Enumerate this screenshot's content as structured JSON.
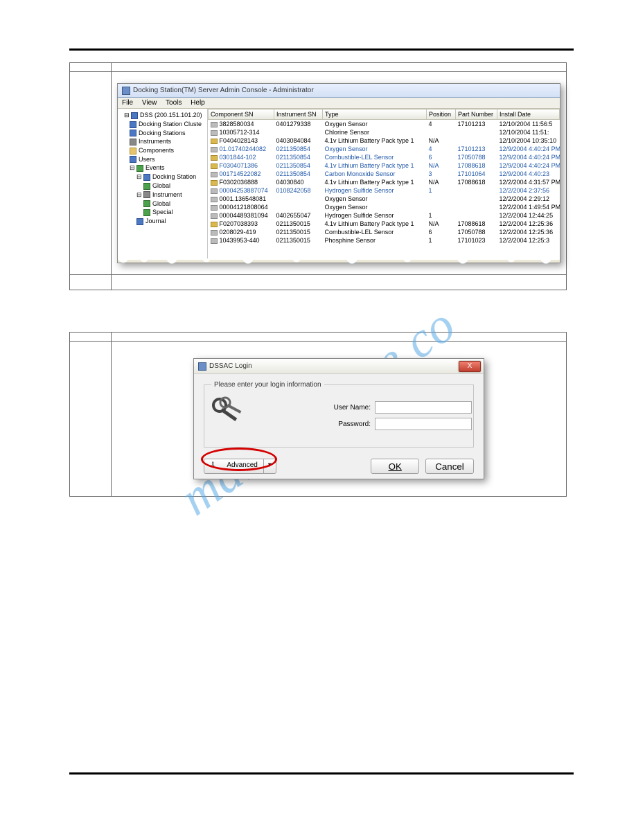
{
  "watermark": "manualshive.co",
  "table1": {
    "stepHeader": "",
    "actionHeader": ""
  },
  "admin": {
    "title": "Docking Station(TM) Server Admin Console - Administrator",
    "menu": {
      "file": "File",
      "view": "View",
      "tools": "Tools",
      "help": "Help"
    },
    "tree": {
      "root": "DSS (200.151.101.20)",
      "items": [
        "Docking Station Cluste",
        "Docking Stations",
        "Instruments",
        "Components",
        "Users",
        "Events"
      ],
      "events": {
        "dock": "Docking Station",
        "global1": "Global",
        "instrument": "Instrument",
        "global2": "Global",
        "special": "Special",
        "journal": "Journal"
      }
    },
    "cols": {
      "c0": "Component SN",
      "c1": "Instrument SN",
      "c2": "Type",
      "c3": "Position",
      "c4": "Part Number",
      "c5": "Install Date"
    },
    "rows": [
      {
        "ic": "g",
        "sn": "3828580034",
        "isn": "0401279338",
        "type": "Oxygen Sensor",
        "pos": "4",
        "pn": "17101213",
        "date": "12/10/2004 11:56:5",
        "blue": false
      },
      {
        "ic": "g",
        "sn": "10305712-314",
        "isn": "",
        "type": "Chlorine Sensor",
        "pos": "",
        "pn": "",
        "date": "12/10/2004 11:51:",
        "blue": false
      },
      {
        "ic": "y",
        "sn": "F0404028143",
        "isn": "0403084084",
        "type": "4.1v Lithium Battery Pack type 1",
        "pos": "N/A",
        "pn": "",
        "date": "12/10/2004 10:35:10",
        "blue": false
      },
      {
        "ic": "g",
        "sn": "01.01740244082",
        "isn": "0211350854",
        "type": "Oxygen Sensor",
        "pos": "4",
        "pn": "17101213",
        "date": "12/9/2004 4:40:24 PM",
        "blue": true
      },
      {
        "ic": "y",
        "sn": "0301844-102",
        "isn": "0211350854",
        "type": "Combustible-LEL Sensor",
        "pos": "6",
        "pn": "17050788",
        "date": "12/9/2004 4:40:24 PM",
        "blue": true
      },
      {
        "ic": "y",
        "sn": "F0304071386",
        "isn": "0211350854",
        "type": "4.1v Lithium Battery Pack type 1",
        "pos": "N/A",
        "pn": "17088618",
        "date": "12/9/2004 4:40:24 PM",
        "blue": true
      },
      {
        "ic": "g",
        "sn": "001714522082",
        "isn": "0211350854",
        "type": "Carbon Monoxide Sensor",
        "pos": "3",
        "pn": "17101064",
        "date": "12/9/2004 4:40:23",
        "blue": true
      },
      {
        "ic": "y",
        "sn": "F0302036888",
        "isn": "04030840",
        "type": "4.1v Lithium Battery Pack type 1",
        "pos": "N/A",
        "pn": "17088618",
        "date": "12/2/2004 4:31:57 PM",
        "blue": false
      },
      {
        "ic": "g",
        "sn": "00004253887074",
        "isn": "0108242058",
        "type": "Hydrogen Sulfide Sensor",
        "pos": "1",
        "pn": "",
        "date": "12/2/2004 2:37:56",
        "blue": true
      },
      {
        "ic": "g",
        "sn": "0001.136548081",
        "isn": "",
        "type": "Oxygen Sensor",
        "pos": "",
        "pn": "",
        "date": "12/2/2004 2:29:12",
        "blue": false
      },
      {
        "ic": "g",
        "sn": "00004121808064",
        "isn": "",
        "type": "Oxygen Sensor",
        "pos": "",
        "pn": "",
        "date": "12/2/2004 1:49:54 PM",
        "blue": false
      },
      {
        "ic": "g",
        "sn": "00004489381094",
        "isn": "0402655047",
        "type": "Hydrogen Sulfide Sensor",
        "pos": "1",
        "pn": "",
        "date": "12/2/2004 12:44:25",
        "blue": false
      },
      {
        "ic": "y",
        "sn": "F0207038393",
        "isn": "0211350015",
        "type": "4.1v Lithium Battery Pack type 1",
        "pos": "N/A",
        "pn": "17088618",
        "date": "12/2/2004 12:25:36",
        "blue": false
      },
      {
        "ic": "g",
        "sn": "0208029-419",
        "isn": "0211350015",
        "type": "Combustible-LEL Sensor",
        "pos": "6",
        "pn": "17050788",
        "date": "12/2/2004 12:25:36",
        "blue": false
      },
      {
        "ic": "g",
        "sn": "10439953-440",
        "isn": "0211350015",
        "type": "Phosphine Sensor",
        "pos": "1",
        "pn": "17101023",
        "date": "12/2/2004 12:25:3",
        "blue": false
      }
    ]
  },
  "login": {
    "title": "DSSAC Login",
    "legend": "Please enter your login information",
    "userLabel": "User Name:",
    "passLabel": "Password:",
    "advanced": "Advanced",
    "ok": "OK",
    "cancel": "Cancel",
    "close": "X"
  }
}
